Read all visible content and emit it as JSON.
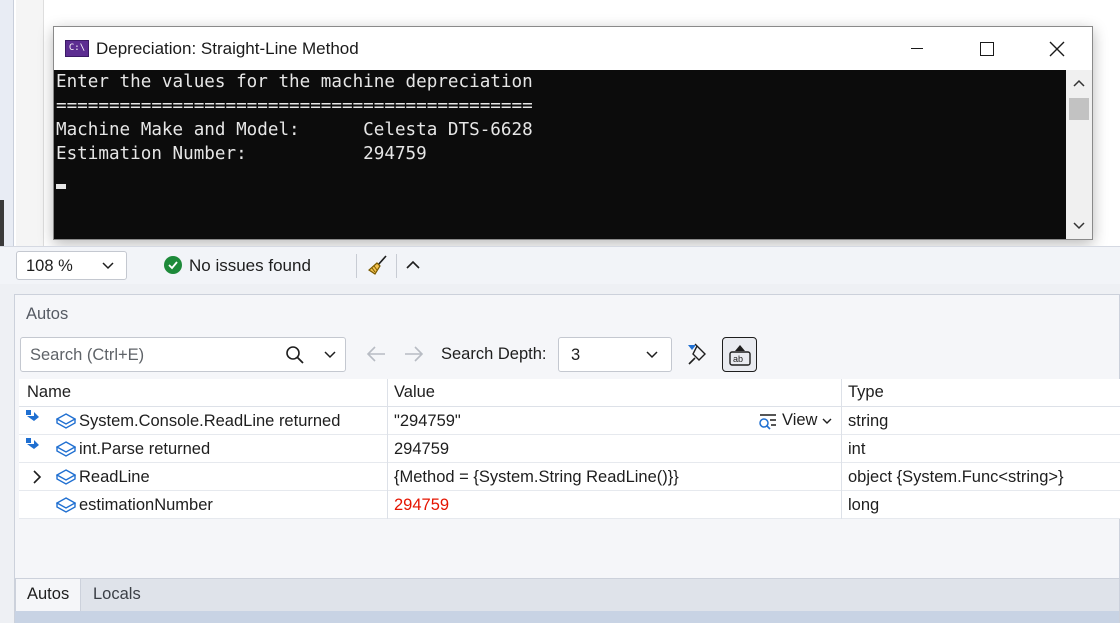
{
  "console": {
    "title": "Depreciation: Straight-Line Method",
    "icon_text": "C:\\",
    "lines": [
      "Enter the values for the machine depreciation",
      "=============================================",
      "Machine Make and Model:      Celesta DTS-6628",
      "Estimation Number:           294759"
    ]
  },
  "status_bar": {
    "zoom": "108 %",
    "issues": "No issues found"
  },
  "autos": {
    "title": "Autos",
    "search_placeholder": "Search (Ctrl+E)",
    "search_depth_label": "Search Depth:",
    "search_depth_value": "3",
    "columns": {
      "name": "Name",
      "value": "Value",
      "type": "Type"
    },
    "view_label": "View",
    "rows": [
      {
        "name": "System.Console.ReadLine returned",
        "value": "\"294759\"",
        "type": "string"
      },
      {
        "name": "int.Parse returned",
        "value": "294759",
        "type": "int"
      },
      {
        "name": "ReadLine",
        "value": "{Method = {System.String ReadLine()}}",
        "type": "object {System.Func<string>}"
      },
      {
        "name": "estimationNumber",
        "value": "294759",
        "type": "long"
      }
    ],
    "tabs": [
      "Autos",
      "Locals"
    ]
  },
  "colors": {
    "console_bg": "#0c0c0c",
    "changed_value": "#e51400",
    "success": "#1e8a3a"
  }
}
